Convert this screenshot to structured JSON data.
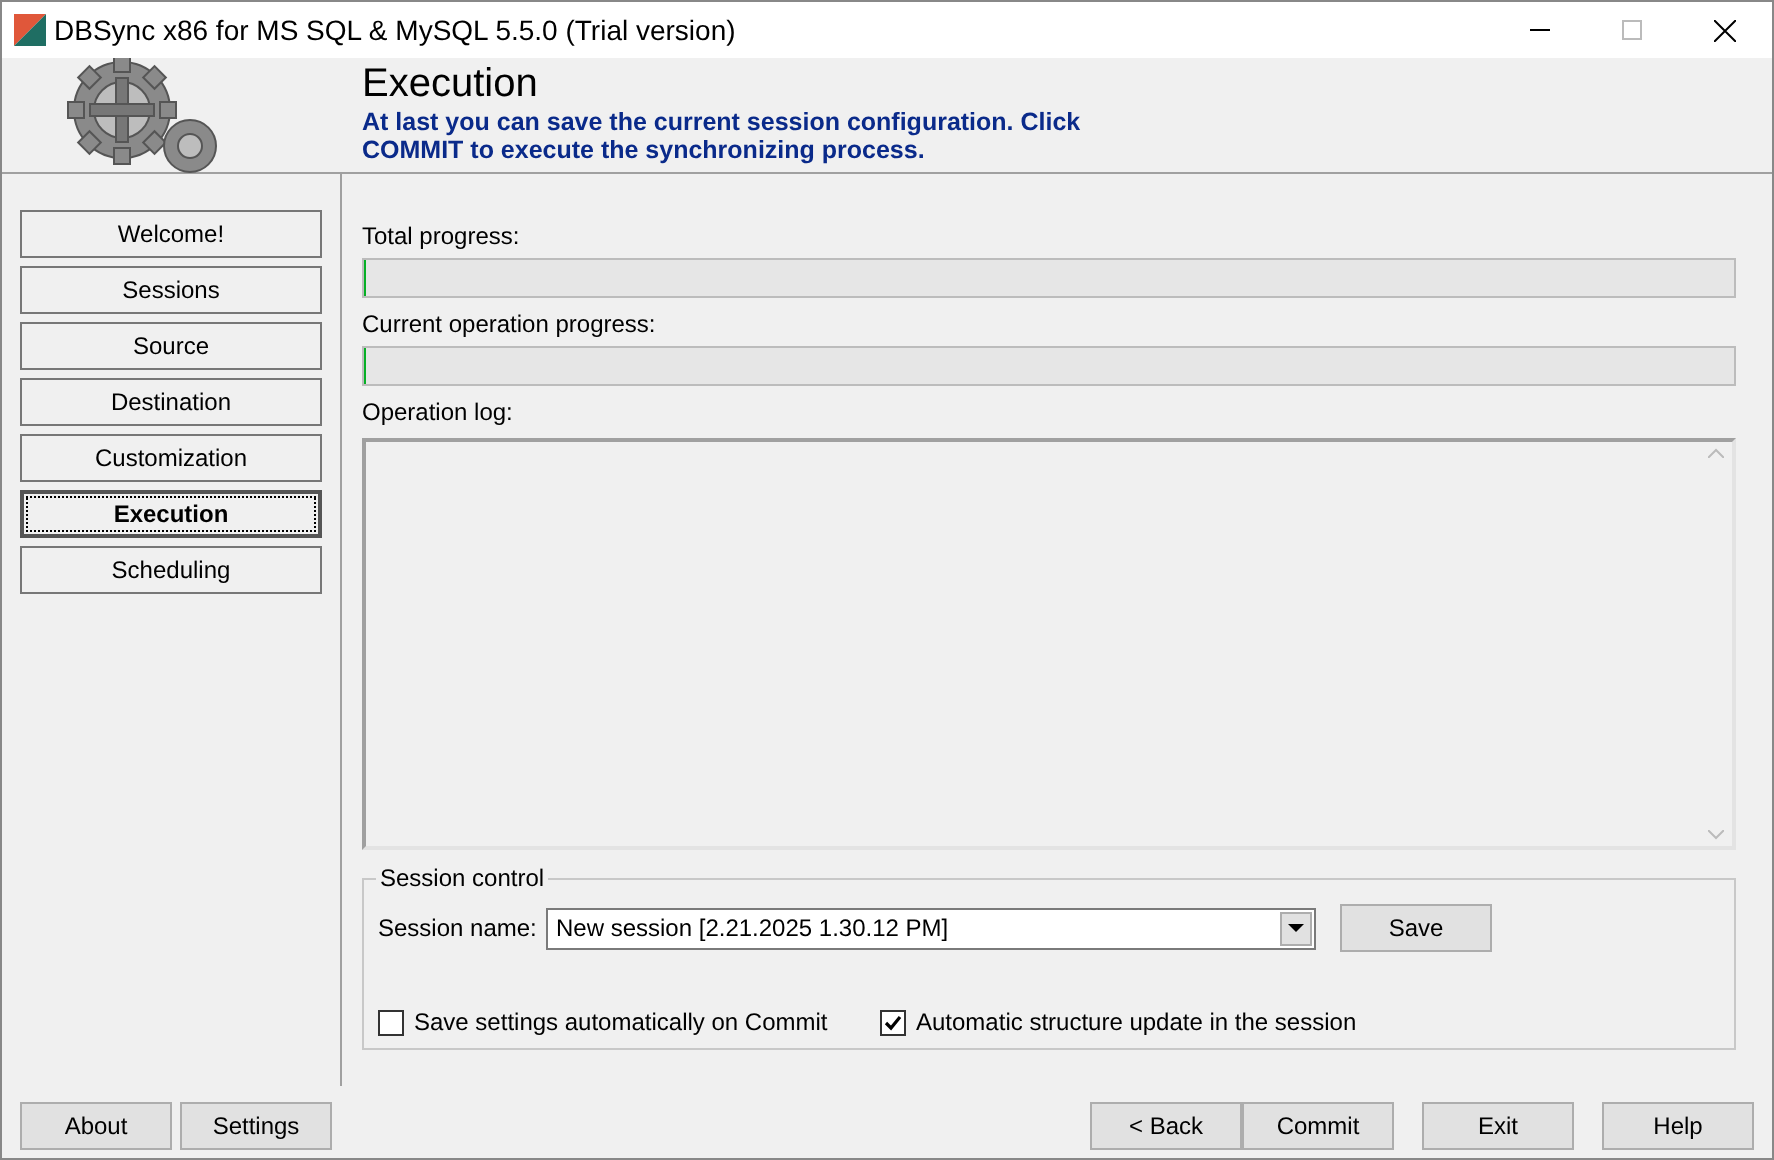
{
  "window": {
    "title": "DBSync x86 for MS SQL & MySQL 5.5.0 (Trial version)"
  },
  "header": {
    "title": "Execution",
    "description": "At last you can save the current session configuration. Click COMMIT to execute the synchronizing process."
  },
  "nav": [
    {
      "label": "Welcome!",
      "selected": false
    },
    {
      "label": "Sessions",
      "selected": false
    },
    {
      "label": "Source",
      "selected": false
    },
    {
      "label": "Destination",
      "selected": false
    },
    {
      "label": "Customization",
      "selected": false
    },
    {
      "label": "Execution",
      "selected": true
    },
    {
      "label": "Scheduling",
      "selected": false
    }
  ],
  "total_progress": {
    "label": "Total progress:",
    "level": 0
  },
  "current_progress": {
    "label": "Current operation progress:",
    "level": 0
  },
  "operation_log": {
    "label": "Operation log:"
  },
  "session_control": {
    "title": "Session control",
    "name_label": "Session name:",
    "name_value": "New session [2.21.2025 1.30.12 PM]",
    "save_button": "Save",
    "options": [
      {
        "label": "Save settings automatically on Commit",
        "checked": false
      },
      {
        "label": "Automatic structure update in the session",
        "checked": true
      }
    ]
  },
  "footer_left": [
    "About",
    "Settings"
  ],
  "footer_right": [
    "< Back",
    "Commit",
    "Exit",
    "Help"
  ]
}
